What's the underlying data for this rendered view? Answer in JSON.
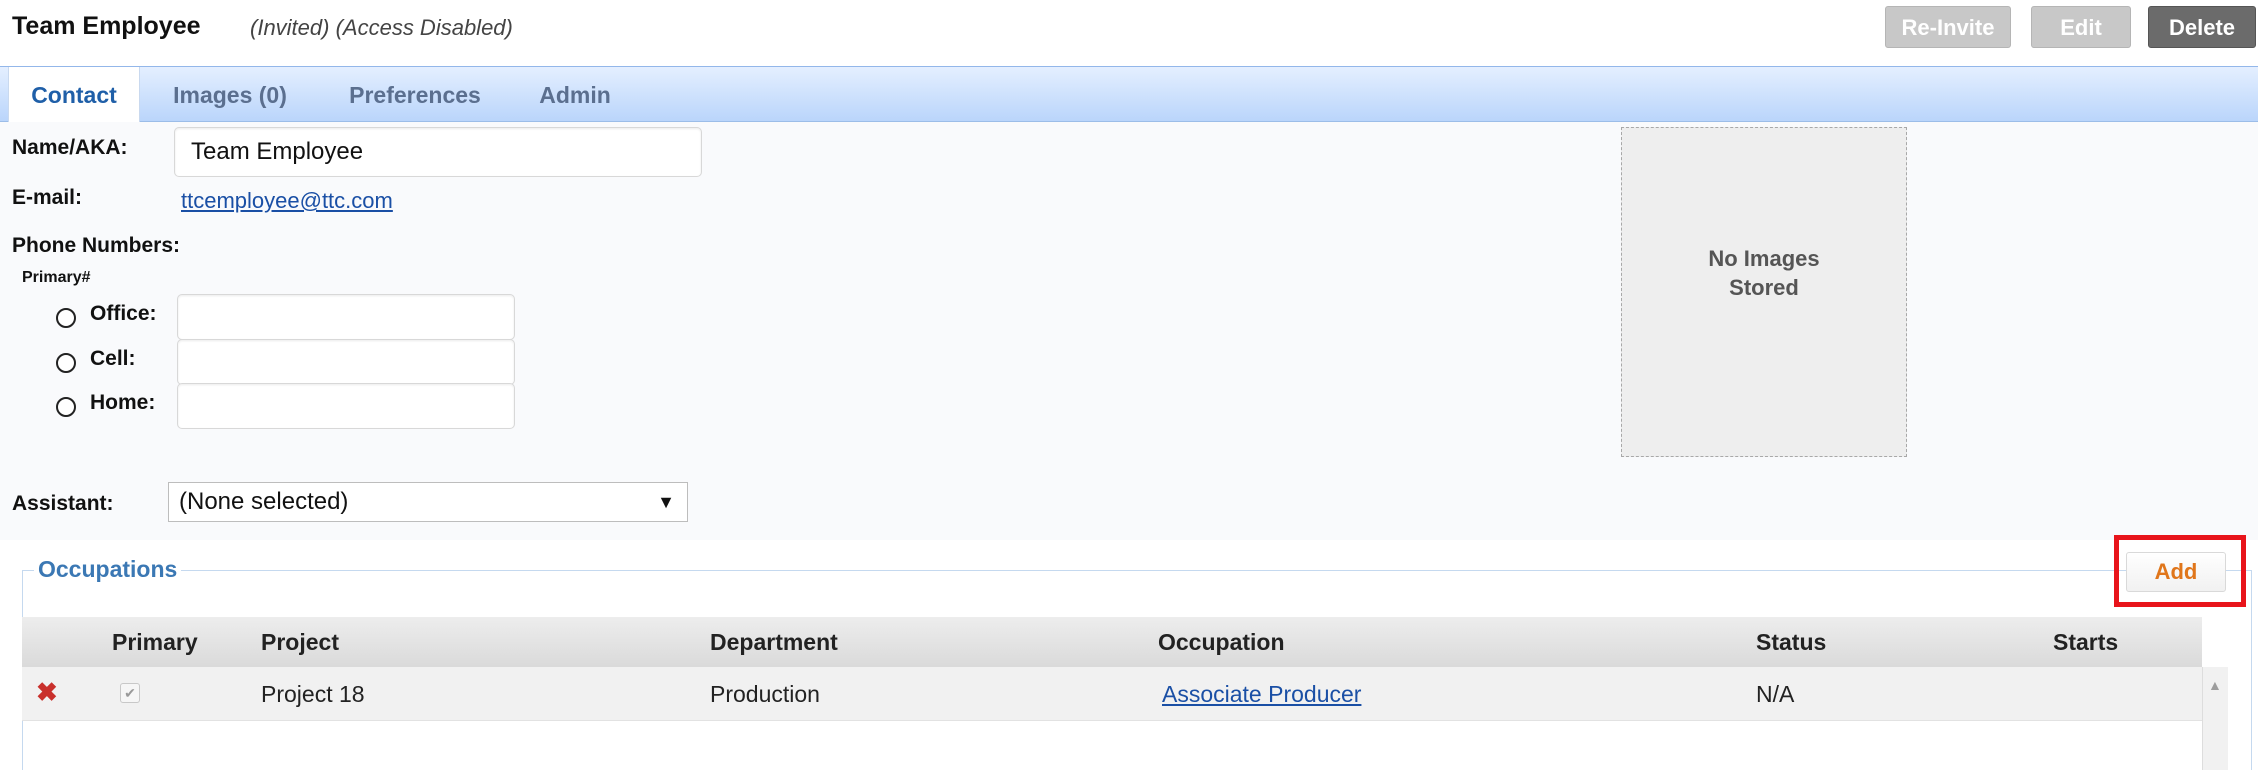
{
  "header": {
    "title": "Team Employee",
    "status": "(Invited) (Access Disabled)",
    "buttons": {
      "reinvite": "Re-Invite",
      "edit": "Edit",
      "delete": "Delete"
    }
  },
  "tabs": [
    {
      "label": "Contact",
      "active": true
    },
    {
      "label": "Images (0)",
      "active": false
    },
    {
      "label": "Preferences",
      "active": false
    },
    {
      "label": "Admin",
      "active": false
    }
  ],
  "contact": {
    "name_label": "Name/AKA:",
    "name_value": "Team Employee",
    "email_label": "E-mail:",
    "email_value": "ttcemployee@ttc.com",
    "phone_label": "Phone Numbers:",
    "primary_label": "Primary#",
    "phones": [
      {
        "label": "Office:",
        "value": ""
      },
      {
        "label": "Cell:",
        "value": ""
      },
      {
        "label": "Home:",
        "value": ""
      }
    ],
    "assistant_label": "Assistant:",
    "assistant_value": "(None selected)"
  },
  "images": {
    "placeholder_line1": "No Images",
    "placeholder_line2": "Stored"
  },
  "occupations": {
    "legend": "Occupations",
    "add_label": "Add",
    "columns": [
      "Primary",
      "Project",
      "Department",
      "Occupation",
      "Status",
      "Starts"
    ],
    "rows": [
      {
        "primary": true,
        "project": "Project 18",
        "department": "Production",
        "occupation": "Associate Producer",
        "status": "N/A",
        "starts": ""
      }
    ]
  },
  "colors": {
    "accent": "#3b78b4",
    "highlight": "#e8141b",
    "add_text": "#e0761b",
    "delete_x": "#c9302c"
  },
  "icons": {
    "delete_row": "close-x-icon",
    "scroll_up": "triangle-up-icon",
    "dropdown": "caret-down-icon"
  }
}
